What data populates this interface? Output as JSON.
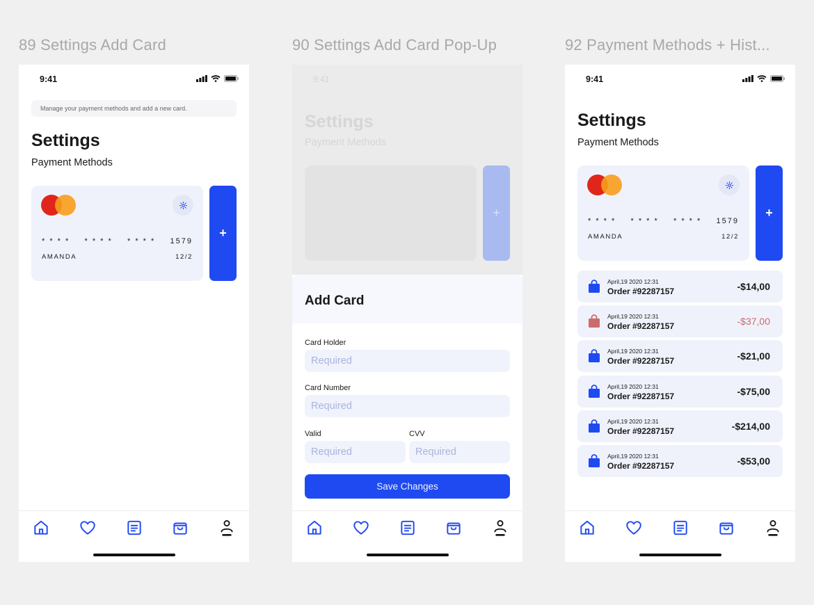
{
  "frames": [
    {
      "title": "89 Settings Add Card"
    },
    {
      "title": "90 Settings Add Card Pop-Up"
    },
    {
      "title": "92 Payment Methods + Hist..."
    }
  ],
  "status": {
    "time": "9:41"
  },
  "settings": {
    "hint": "Manage your payment methods and add a new card.",
    "title": "Settings",
    "subtitle": "Payment Methods",
    "add_label": "+"
  },
  "card": {
    "groups": [
      "* * * *",
      "* * * *",
      "* * * *",
      "1579"
    ],
    "holder": "AMANDA",
    "expiry": "12/2",
    "brand_colors": {
      "red": "#e0261b",
      "orange": "#f79e1b"
    }
  },
  "popup": {
    "title": "Add Card",
    "fields": {
      "holder_label": "Card Holder",
      "number_label": "Card Number",
      "valid_label": "Valid",
      "cvv_label": "CVV",
      "placeholder": "Required"
    },
    "save_label": "Save Changes"
  },
  "history": [
    {
      "date": "April,19 2020 12:31",
      "order": "Order #92287157",
      "amount": "-$14,00",
      "status": "normal"
    },
    {
      "date": "April,19 2020 12:31",
      "order": "Order #92287157",
      "amount": "-$37,00",
      "status": "alert"
    },
    {
      "date": "April,19 2020 12:31",
      "order": "Order #92287157",
      "amount": "-$21,00",
      "status": "normal"
    },
    {
      "date": "April,19 2020 12:31",
      "order": "Order #92287157",
      "amount": "-$75,00",
      "status": "normal"
    },
    {
      "date": "April,19 2020 12:31",
      "order": "Order #92287157",
      "amount": "-$214,00",
      "status": "normal"
    },
    {
      "date": "April,19 2020 12:31",
      "order": "Order #92287157",
      "amount": "-$53,00",
      "status": "normal"
    }
  ],
  "tabs": [
    {
      "name": "home",
      "icon": "home-icon"
    },
    {
      "name": "favorites",
      "icon": "heart-icon"
    },
    {
      "name": "orders",
      "icon": "list-icon"
    },
    {
      "name": "cart",
      "icon": "bag-icon"
    },
    {
      "name": "profile",
      "icon": "user-icon"
    }
  ],
  "colors": {
    "accent": "#1f4af1",
    "card_bg": "#eff2fb",
    "alert": "#cc6b6b"
  }
}
